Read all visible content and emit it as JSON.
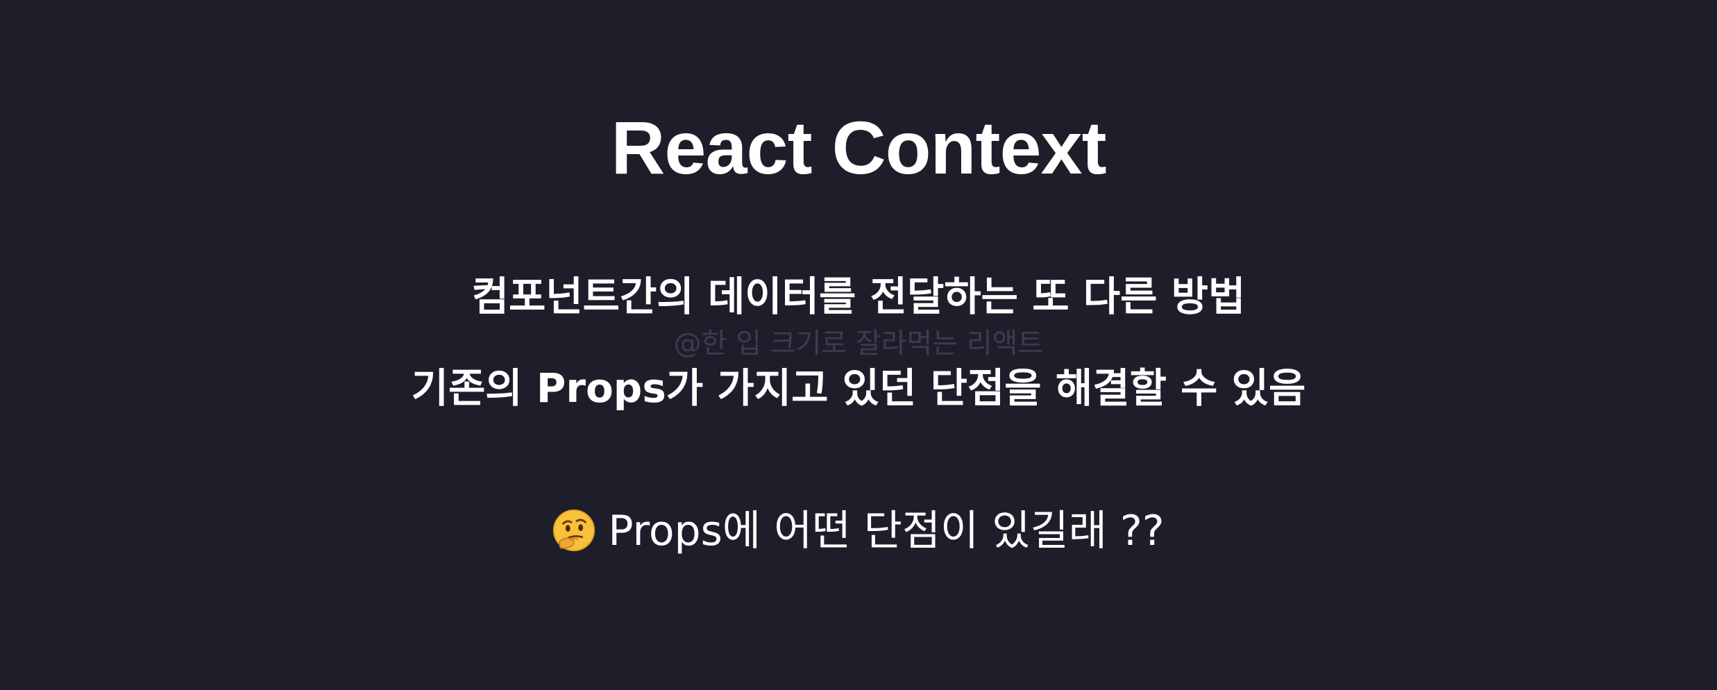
{
  "slide": {
    "title": "React Context",
    "subtitle_line1": "컴포넌트간의 데이터를 전달하는 또 다른 방법",
    "watermark": "@한 입 크기로 잘라먹는 리액트",
    "subtitle_line2": "기존의 Props가 가지고 있던 단점을 해결할 수 있음",
    "question": {
      "icon": "thinking-face-icon",
      "text": "Props에 어떤 단점이 있길래 ??"
    }
  },
  "colors": {
    "background": "#1e1e2b",
    "text": "#ffffff",
    "watermark": "#3c3c4c"
  }
}
